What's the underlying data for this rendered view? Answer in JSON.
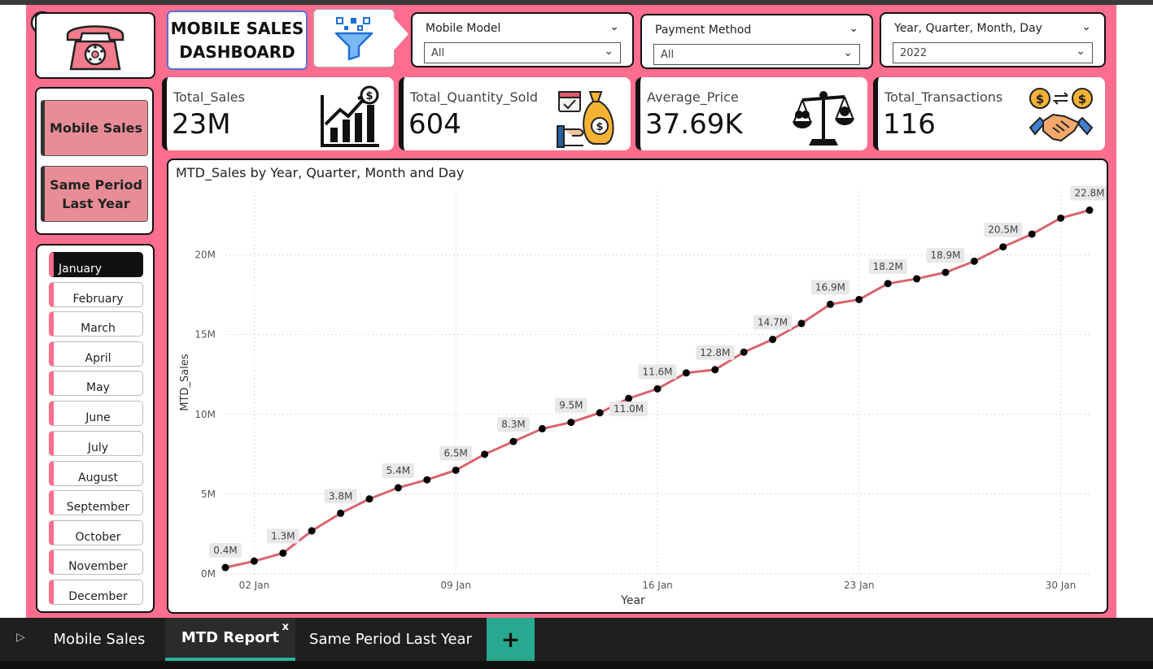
{
  "dashboard": {
    "title_line1": "MOBILE SALES",
    "title_line2": "DASHBOARD"
  },
  "slicers": {
    "mobile_model": {
      "title": "Mobile Model",
      "value": "All"
    },
    "payment_method": {
      "title": "Payment Method",
      "value": "All"
    },
    "date": {
      "title": "Year, Quarter, Month, Day",
      "value": "2022"
    }
  },
  "kpis": [
    {
      "label": "Total_Sales",
      "value": "23M",
      "icon": "growth-chart-dollar-icon"
    },
    {
      "label": "Total_Quantity_Sold",
      "value": "604",
      "icon": "money-bag-hand-icon"
    },
    {
      "label": "Average_Price",
      "value": "37.69K",
      "icon": "balance-scale-icon"
    },
    {
      "label": "Total_Transactions",
      "value": "116",
      "icon": "handshake-dollar-icon"
    }
  ],
  "nav": {
    "mobile_sales": "Mobile Sales",
    "same_period_line1": "Same Period",
    "same_period_line2": "Last Year"
  },
  "months": {
    "selected": "January",
    "items": [
      "January",
      "February",
      "March",
      "April",
      "May",
      "June",
      "July",
      "August",
      "September",
      "October",
      "November",
      "December"
    ]
  },
  "chart_data": {
    "type": "line",
    "title": "MTD_Sales by Year, Quarter, Month and Day",
    "xlabel": "Year",
    "ylabel": "MTD_Sales",
    "x_tick_labels": [
      "02 Jan",
      "09 Jan",
      "16 Jan",
      "23 Jan",
      "30 Jan"
    ],
    "x_tick_days": [
      2,
      9,
      16,
      23,
      30
    ],
    "xlim": [
      1,
      31
    ],
    "y_tick_labels": [
      "0M",
      "5M",
      "10M",
      "15M",
      "20M"
    ],
    "y_ticks": [
      0,
      5,
      10,
      15,
      20
    ],
    "ylim": [
      0,
      24
    ],
    "grid": true,
    "color": "#d9646e",
    "x": [
      1,
      2,
      3,
      4,
      5,
      6,
      7,
      8,
      9,
      10,
      11,
      12,
      13,
      14,
      15,
      16,
      17,
      18,
      19,
      20,
      21,
      22,
      23,
      24,
      25,
      26,
      27,
      28,
      29,
      30,
      31
    ],
    "values": [
      0.4,
      0.8,
      1.3,
      2.7,
      3.8,
      4.7,
      5.4,
      5.9,
      6.5,
      7.5,
      8.3,
      9.1,
      9.5,
      10.1,
      11.0,
      11.6,
      12.6,
      12.8,
      13.9,
      14.7,
      15.7,
      16.9,
      17.2,
      18.2,
      18.5,
      18.9,
      19.6,
      20.5,
      21.3,
      22.3,
      22.8
    ],
    "data_labels": [
      {
        "index": 0,
        "text": "0.4M"
      },
      {
        "index": 2,
        "text": "1.3M"
      },
      {
        "index": 4,
        "text": "3.8M"
      },
      {
        "index": 6,
        "text": "5.4M"
      },
      {
        "index": 8,
        "text": "6.5M"
      },
      {
        "index": 10,
        "text": "8.3M"
      },
      {
        "index": 12,
        "text": "9.5M"
      },
      {
        "index": 14,
        "text": "11.0M"
      },
      {
        "index": 15,
        "text": "11.6M"
      },
      {
        "index": 17,
        "text": "12.8M"
      },
      {
        "index": 19,
        "text": "14.7M"
      },
      {
        "index": 21,
        "text": "16.9M"
      },
      {
        "index": 23,
        "text": "18.2M"
      },
      {
        "index": 25,
        "text": "18.9M"
      },
      {
        "index": 27,
        "text": "20.5M"
      },
      {
        "index": 30,
        "text": "22.8M"
      }
    ]
  },
  "tabs": {
    "items": [
      "Mobile Sales",
      "MTD Report",
      "Same Period Last Year"
    ],
    "active": "MTD Report",
    "close": "x",
    "add": "+"
  },
  "colors": {
    "canvas": "#fc6d8e",
    "accent_teal": "#26a98f"
  }
}
